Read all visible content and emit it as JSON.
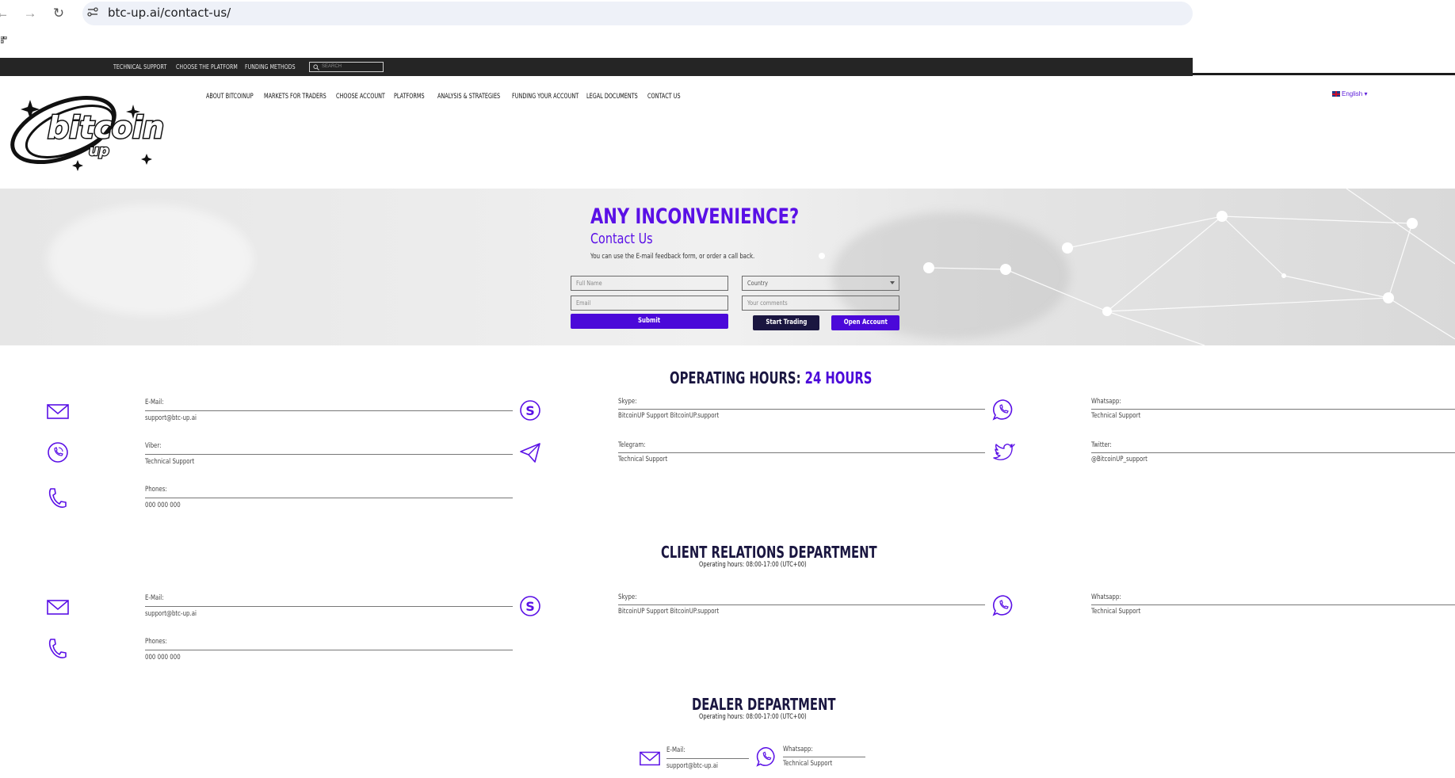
{
  "browser": {
    "url": "btc-up.ai/contact-us/"
  },
  "topbar": {
    "links": [
      "TECHNICAL SUPPORT",
      "CHOOSE THE PLATFORM",
      "FUNDING METHODS"
    ],
    "search_placeholder": "SEARCH"
  },
  "header": {
    "logo_text": "bitcoin up",
    "nav": [
      "ABOUT BITCOINUP",
      "MARKETS FOR TRADERS",
      "CHOOSE ACCOUNT",
      "PLATFORMS",
      "ANALYSIS & STRATEGIES",
      "FUNDING YOUR ACCOUNT",
      "LEGAL DOCUMENTS",
      "CONTACT US"
    ],
    "language": "English"
  },
  "hero": {
    "title": "ANY INCONVENIENCE?",
    "subtitle": "Contact Us",
    "description": "You can use the E-mail feedback form, or order a call back.",
    "form": {
      "full_name_placeholder": "Full Name",
      "country_placeholder": "Country",
      "email_placeholder": "Email",
      "comments_placeholder": "Your comments",
      "submit_label": "Submit",
      "start_trading_label": "Start Trading",
      "open_account_label": "Open Account"
    }
  },
  "operating": {
    "title": "OPERATING HOURS:",
    "title_accent": "24 HOURS",
    "contacts": [
      {
        "icon": "mail-icon",
        "label": "E-Mail:",
        "value": "support@btc-up.ai"
      },
      {
        "icon": "skype-icon",
        "label": "Skype:",
        "value": "BitcoinUP Support BitcoinUP.support"
      },
      {
        "icon": "whatsapp-icon",
        "label": "Whatsapp:",
        "value": "Technical Support"
      },
      {
        "icon": "viber-icon",
        "label": "Viber:",
        "value": "Technical Support"
      },
      {
        "icon": "telegram-icon",
        "label": "Telegram:",
        "value": "Technical Support"
      },
      {
        "icon": "twitter-icon",
        "label": "Twitter:",
        "value": "@BitcoinUP_support"
      },
      {
        "icon": "phone-icon",
        "label": "Phones:",
        "value": "000 000 000"
      }
    ]
  },
  "client_relations": {
    "title": "CLIENT RELATIONS DEPARTMENT",
    "hours": "Operating hours: 08:00-17:00 (UTC+00)",
    "contacts": [
      {
        "icon": "mail-icon",
        "label": "E-Mail:",
        "value": "support@btc-up.ai"
      },
      {
        "icon": "skype-icon",
        "label": "Skype:",
        "value": "BitcoinUP Support BitcoinUP.support"
      },
      {
        "icon": "whatsapp-icon",
        "label": "Whatsapp:",
        "value": "Technical Support"
      },
      {
        "icon": "phone-icon",
        "label": "Phones:",
        "value": "000 000 000"
      }
    ]
  },
  "dealer": {
    "title": "DEALER DEPARTMENT",
    "hours": "Operating hours: 08:00-17:00 (UTC+00)",
    "contacts": [
      {
        "icon": "mail-icon",
        "label": "E-Mail:",
        "value": "support@btc-up.ai"
      },
      {
        "icon": "whatsapp-icon",
        "label": "Whatsapp:",
        "value": "Technical Support"
      }
    ]
  },
  "colors": {
    "accent": "#4b09d9",
    "dark": "#1a1640",
    "topbar": "#252525"
  }
}
